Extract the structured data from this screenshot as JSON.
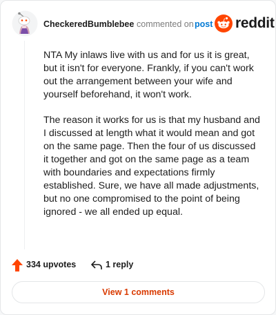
{
  "comment": {
    "username": "CheckeredBumblebee",
    "action_text": "commented on",
    "post_link": "post",
    "paragraphs": [
      "NTA My inlaws live with us and for us it is great, but it isn't for everyone. Frankly, if you can't work out the arrangement between your wife and yourself beforehand, it won't work.",
      "The reason it works for us is that my husband and I discussed at length what it would mean and got on the same page. Then the four of us discussed it together and got on the same page as a team with boundaries and expectations firmly established. Sure, we have all made adjustments, but no one compromised to the point of being ignored - we all ended up equal."
    ]
  },
  "brand": {
    "name": "reddit",
    "icon": "reddit-logo-icon",
    "color": "#ff4500"
  },
  "actions": {
    "upvotes": "334 upvotes",
    "upvote_icon": "upvote-arrow-icon",
    "replies": "1 reply",
    "reply_icon": "reply-arrow-icon"
  },
  "footer": {
    "view_comments": "View 1 comments"
  },
  "colors": {
    "accent": "#ff4500",
    "link": "#0079d3",
    "view_button_text": "#d93a00"
  }
}
